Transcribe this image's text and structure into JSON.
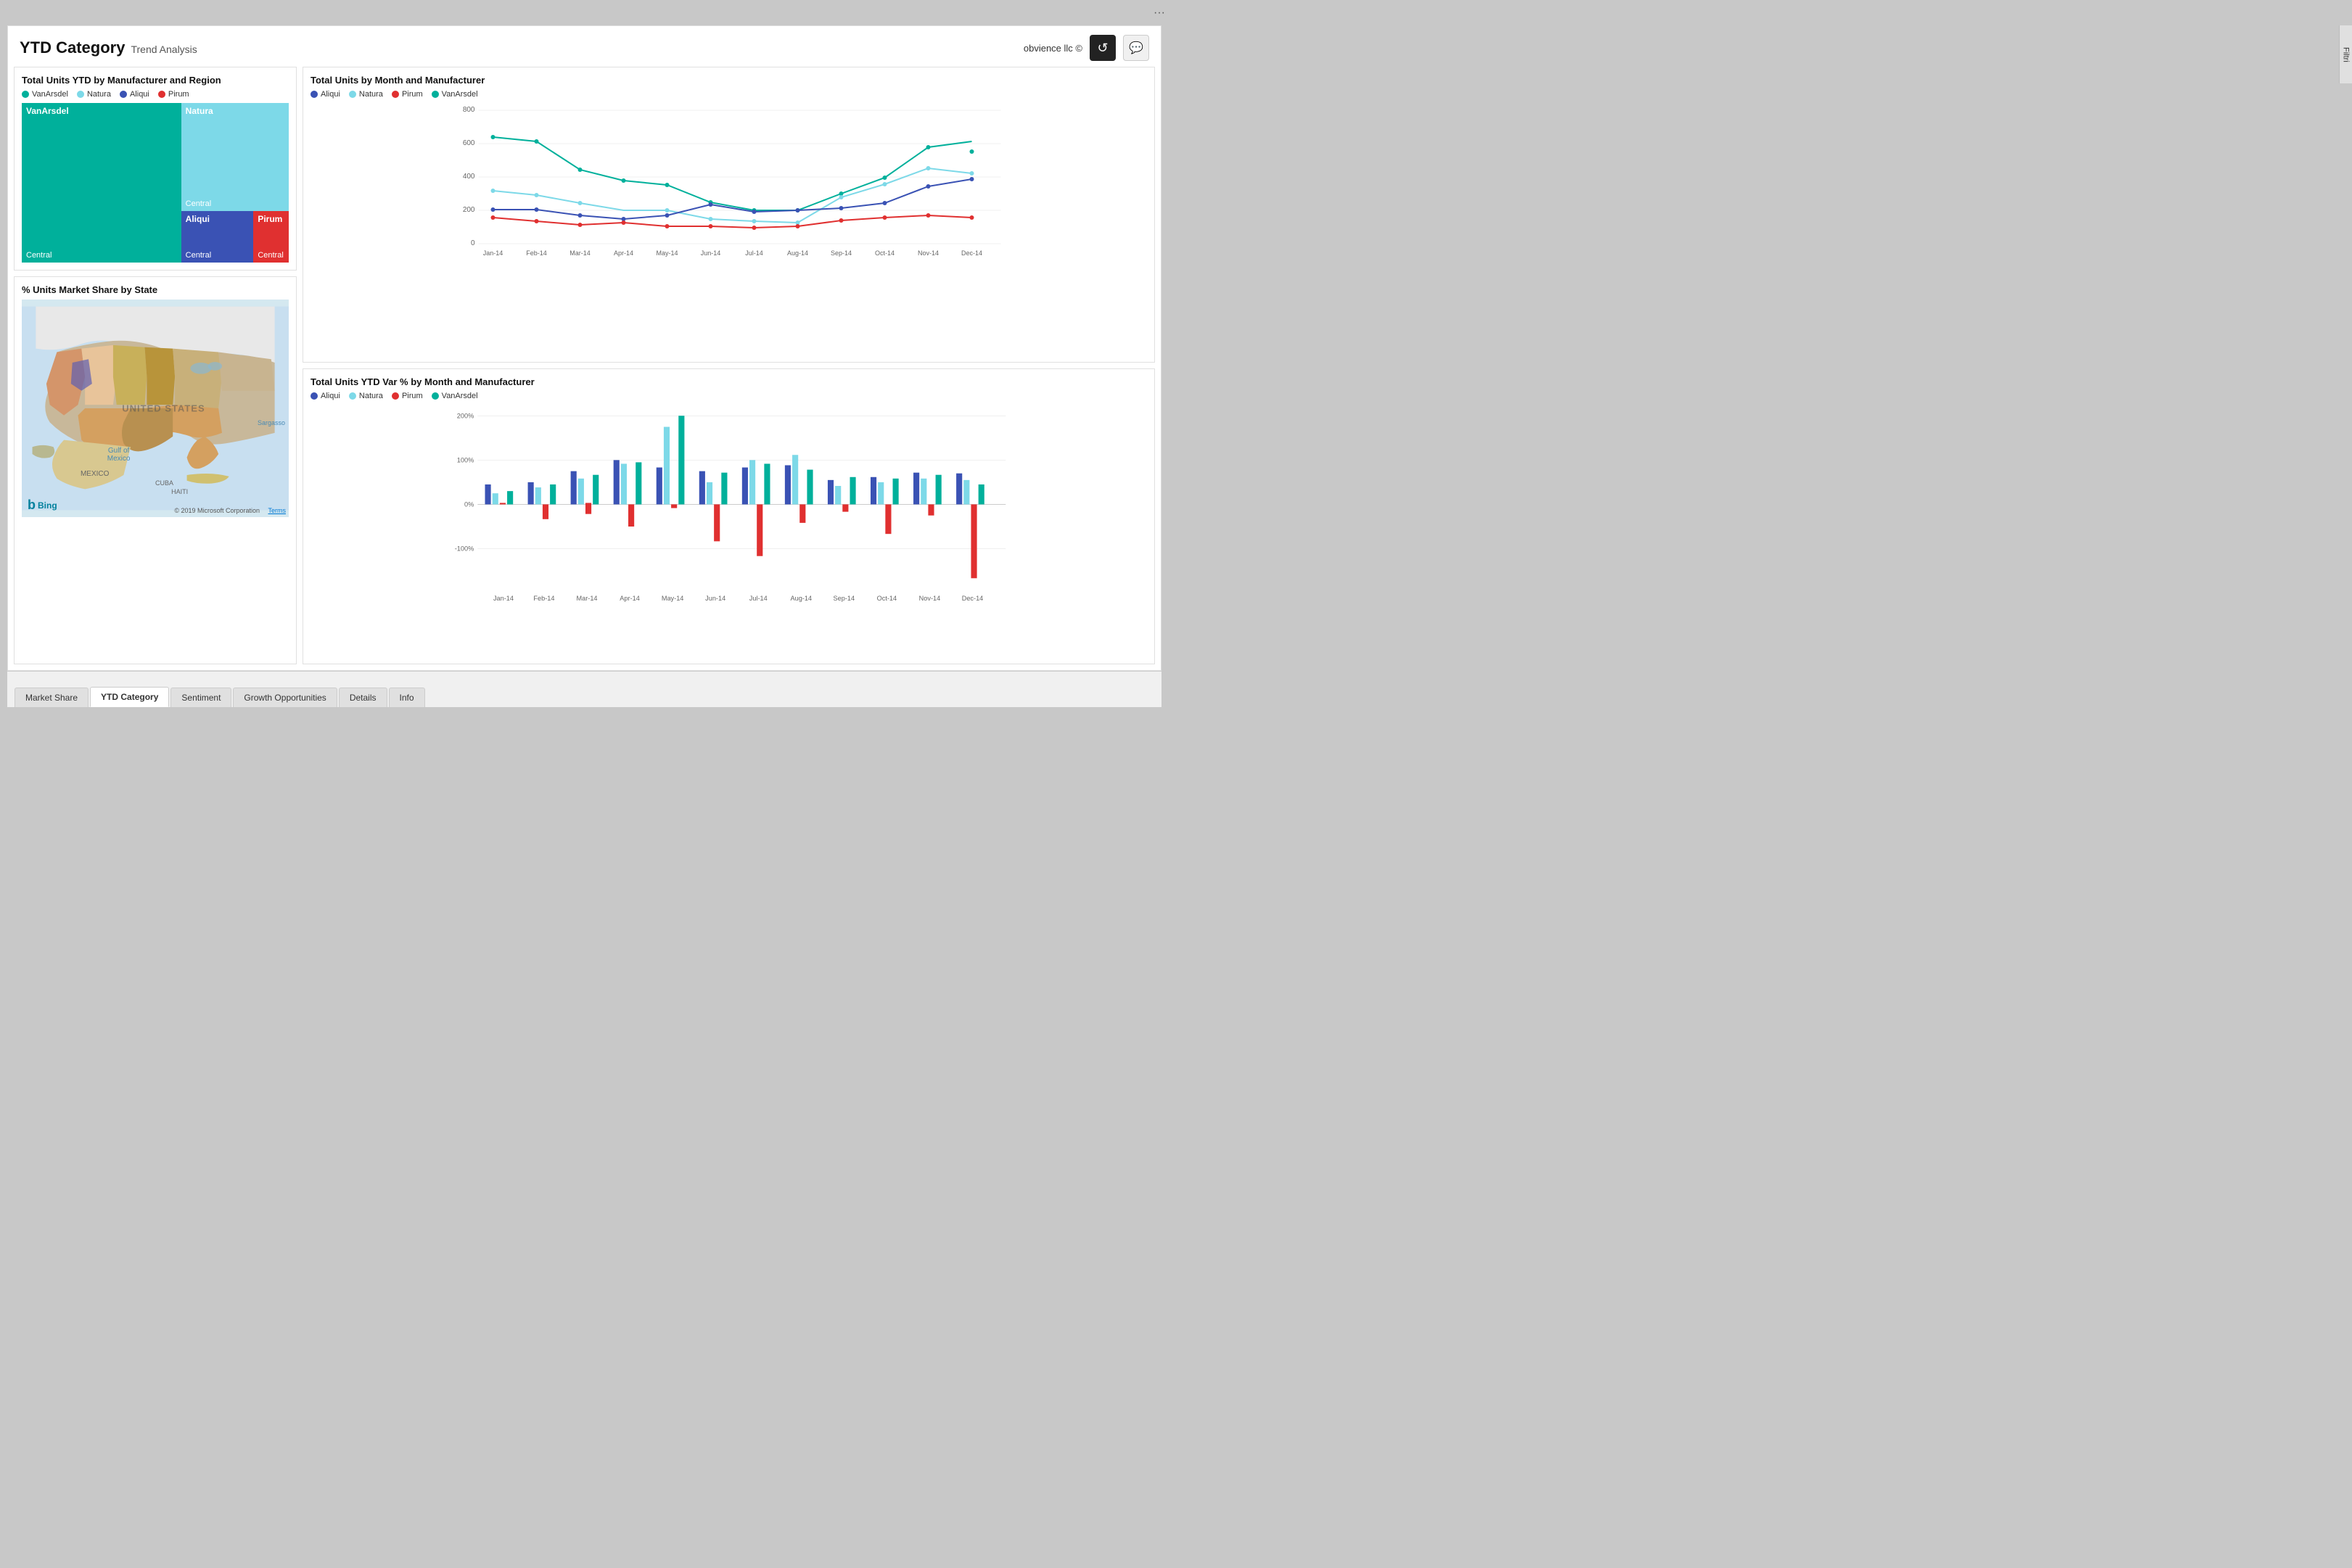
{
  "header": {
    "title_main": "YTD Category",
    "title_sub": "Trend Analysis",
    "brand": "obvience llc ©",
    "filter_label": "Filtri"
  },
  "tabs": [
    {
      "id": "market-share",
      "label": "Market Share",
      "active": false
    },
    {
      "id": "ytd-category",
      "label": "YTD Category",
      "active": true
    },
    {
      "id": "sentiment",
      "label": "Sentiment",
      "active": false
    },
    {
      "id": "growth-opportunities",
      "label": "Growth Opportunities",
      "active": false
    },
    {
      "id": "details",
      "label": "Details",
      "active": false
    },
    {
      "id": "info",
      "label": "Info",
      "active": false
    }
  ],
  "treemap": {
    "title": "Total Units YTD by Manufacturer and Region",
    "legend": [
      {
        "label": "VanArsdel",
        "color": "#00b09b"
      },
      {
        "label": "Natura",
        "color": "#7dd9e8"
      },
      {
        "label": "Aliqui",
        "color": "#3a52b4"
      },
      {
        "label": "Pirum",
        "color": "#e03030"
      }
    ],
    "segments": [
      {
        "label": "VanArsdel",
        "sub": "Central",
        "color": "#00b09b"
      },
      {
        "label": "Natura",
        "sub": "Central",
        "color": "#7dd9e8"
      },
      {
        "label": "Aliqui",
        "sub": "Central",
        "color": "#3a52b4"
      },
      {
        "label": "Pirum",
        "sub": "Central",
        "color": "#e03030"
      }
    ]
  },
  "line_chart": {
    "title": "Total Units by Month and Manufacturer",
    "legend": [
      {
        "label": "Aliqui",
        "color": "#3a52b4"
      },
      {
        "label": "Natura",
        "color": "#7dd9e8"
      },
      {
        "label": "Pirum",
        "color": "#e03030"
      },
      {
        "label": "VanArsdel",
        "color": "#00b09b"
      }
    ],
    "y_labels": [
      "800",
      "600",
      "400",
      "200",
      "0"
    ],
    "x_labels": [
      "Jan-14",
      "Feb-14",
      "Mar-14",
      "Apr-14",
      "May-14",
      "Jun-14",
      "Jul-14",
      "Aug-14",
      "Sep-14",
      "Oct-14",
      "Nov-14",
      "Dec-14"
    ]
  },
  "map": {
    "title": "% Units Market Share by State",
    "labels": {
      "us": "UNITED STATES",
      "gulf": "Gulf of\nMexico",
      "mexico": "MEXICO",
      "sargasso": "Sargasso",
      "cuba": "CUBA",
      "haiti": "HAITI",
      "copyright": "© 2019 Microsoft Corporation",
      "terms": "Terms",
      "bing": "Bing"
    }
  },
  "bar_chart": {
    "title": "Total Units YTD Var % by Month and Manufacturer",
    "legend": [
      {
        "label": "Aliqui",
        "color": "#3a52b4"
      },
      {
        "label": "Natura",
        "color": "#7dd9e8"
      },
      {
        "label": "Pirum",
        "color": "#e03030"
      },
      {
        "label": "VanArsdel",
        "color": "#00b09b"
      }
    ],
    "y_labels": [
      "200%",
      "100%",
      "0%",
      "-100%"
    ],
    "x_labels": [
      "Jan-14",
      "Feb-14",
      "Mar-14",
      "Apr-14",
      "May-14",
      "Jun-14",
      "Jul-14",
      "Aug-14",
      "Sep-14",
      "Oct-14",
      "Nov-14",
      "Dec-14"
    ]
  },
  "icons": {
    "refresh": "↺",
    "chat": "💬",
    "dots": "···",
    "bing_b": "Ƀ"
  }
}
